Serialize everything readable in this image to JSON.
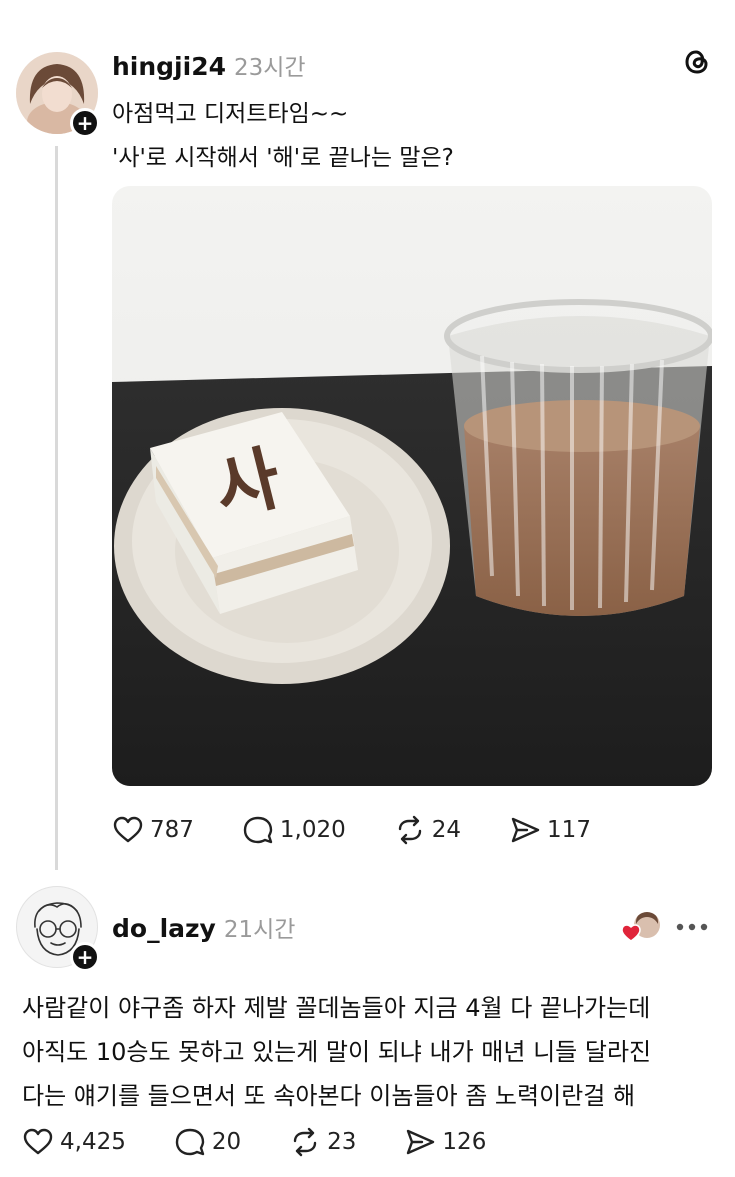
{
  "post": {
    "username": "hingji24",
    "time": "23시간",
    "lines": [
      "아점먹고 디저트타임~~",
      "'사'로 시작해서 '해'로 끝나는 말은?"
    ],
    "cake_text": "사",
    "stats": {
      "likes": "787",
      "comments": "1,020",
      "reposts": "24",
      "shares": "117"
    }
  },
  "reply": {
    "username": "do_lazy",
    "time": "21시간",
    "lines": [
      "사람같이 야구좀 하자 제발 꼴데놈들아 지금 4월 다 끝나가는데",
      "아직도 10승도 못하고 있는게 말이 되냐 내가 매년 니들 달라진",
      "다는 얘기를 들으면서 또 속아본다 이놈들아 좀 노력이란걸 해"
    ],
    "stats": {
      "likes": "4,425",
      "comments": "20",
      "reposts": "23",
      "shares": "126"
    }
  },
  "colors": {
    "heart_liked": "#e0243a",
    "muted": "#9a9a9a",
    "thread_line": "#d9d9d9"
  }
}
